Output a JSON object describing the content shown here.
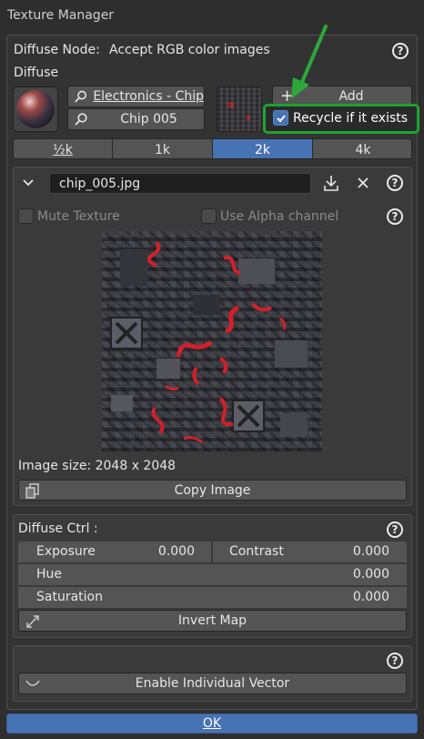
{
  "window": {
    "title": "Texture Manager"
  },
  "node": {
    "label": "Diffuse Node:",
    "description": "Accept RGB color images",
    "section_label": "Diffuse"
  },
  "search": {
    "category_value": "Electronics - Chip",
    "texture_value": "Chip 005"
  },
  "actions": {
    "add_label": "Add",
    "recycle_label": "Recycle if it exists",
    "recycle_checked": true
  },
  "resolution": {
    "options": [
      "½k",
      "1k",
      "2k",
      "4k"
    ],
    "selected": "2k"
  },
  "file": {
    "name": "chip_005.jpg",
    "mute_texture_label": "Mute Texture",
    "use_alpha_label": "Use Alpha channel",
    "image_size_text": "Image size: 2048 x 2048",
    "copy_image_label": "Copy Image"
  },
  "diffuse_ctrl": {
    "title": "Diffuse Ctrl :",
    "exposure_label": "Exposure",
    "exposure_value": "0.000",
    "contrast_label": "Contrast",
    "contrast_value": "0.000",
    "hue_label": "Hue",
    "hue_value": "0.000",
    "saturation_label": "Saturation",
    "saturation_value": "0.000",
    "invert_map_label": "Invert Map"
  },
  "vector": {
    "enable_label": "Enable Individual Vector"
  },
  "footer": {
    "ok_label": "OK"
  },
  "colors": {
    "accent": "#4772b3",
    "highlight_border": "#1fa22e",
    "arrow": "#2ea73a"
  }
}
